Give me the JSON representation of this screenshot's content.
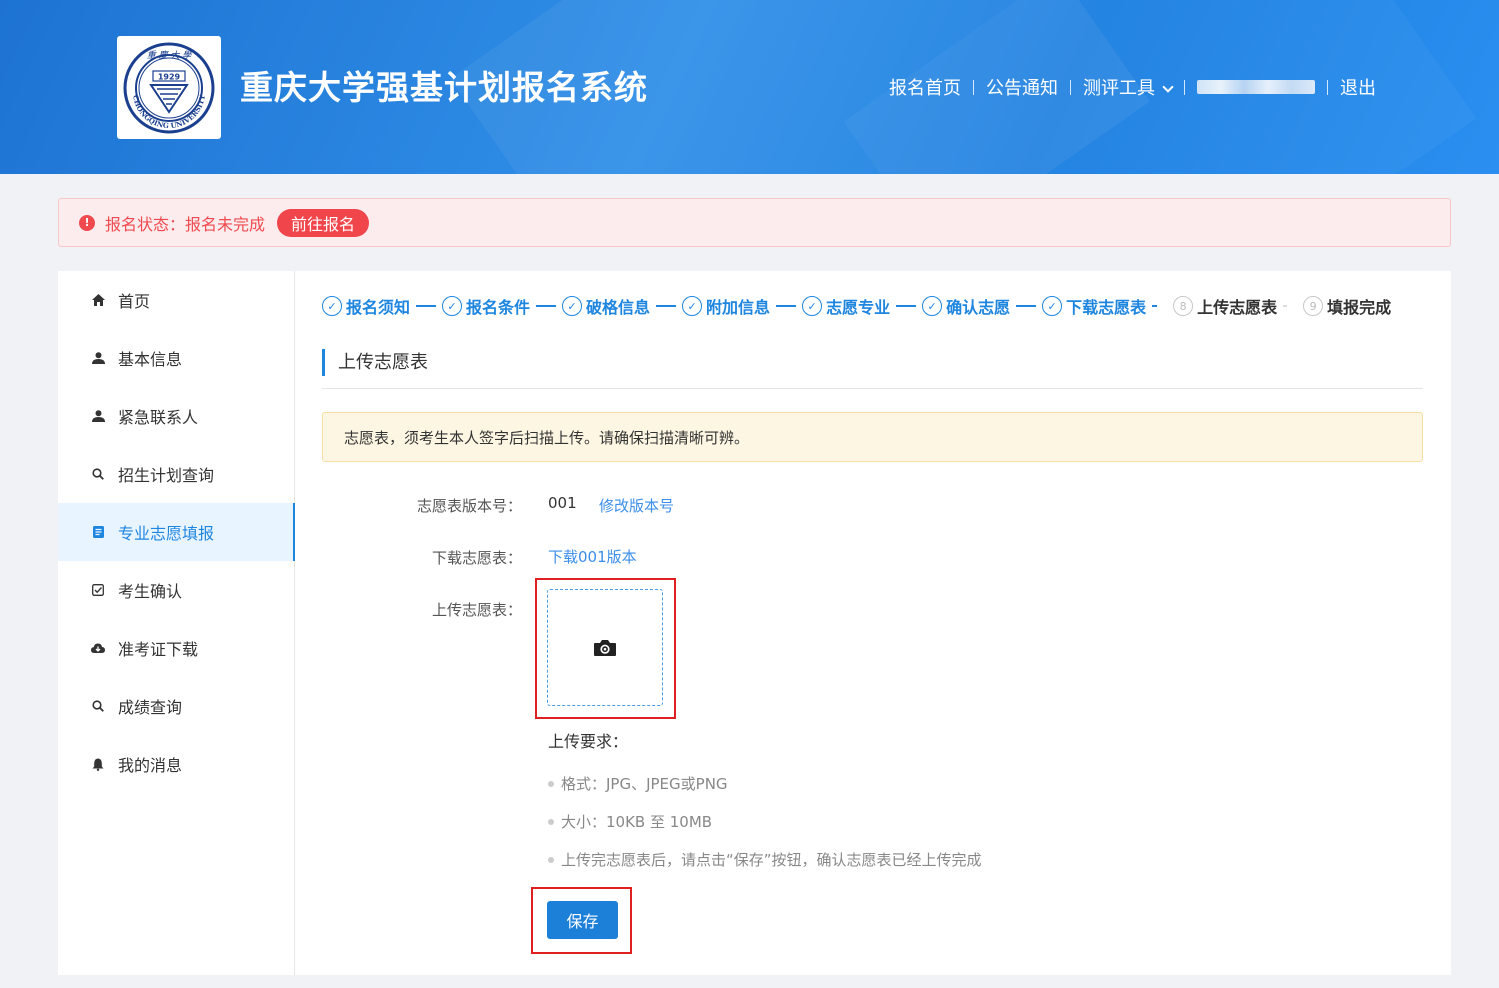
{
  "header": {
    "site_title": "重庆大学强基计划报名系统",
    "logo_alt_text": "重庆大学 1929 CHONGQING UNIVERSITY",
    "nav": {
      "home": "报名首页",
      "notices": "公告通知",
      "tools": "测评工具",
      "logout": "退出"
    }
  },
  "status": {
    "icon": "!",
    "text": "报名状态：报名未完成",
    "button": "前往报名"
  },
  "sidebar": {
    "items": [
      {
        "label": "首页",
        "icon": "home-icon"
      },
      {
        "label": "基本信息",
        "icon": "user-icon"
      },
      {
        "label": "紧急联系人",
        "icon": "user-icon"
      },
      {
        "label": "招生计划查询",
        "icon": "search-icon"
      },
      {
        "label": "专业志愿填报",
        "icon": "document-icon",
        "active": true
      },
      {
        "label": "考生确认",
        "icon": "checkbox-icon"
      },
      {
        "label": "准考证下载",
        "icon": "cloud-download-icon"
      },
      {
        "label": "成绩查询",
        "icon": "search-icon"
      },
      {
        "label": "我的消息",
        "icon": "bell-icon"
      }
    ]
  },
  "steps": {
    "items": [
      {
        "label": "报名须知",
        "marker": "✓",
        "state": "done"
      },
      {
        "label": "报名条件",
        "marker": "✓",
        "state": "done"
      },
      {
        "label": "破格信息",
        "marker": "✓",
        "state": "done"
      },
      {
        "label": "附加信息",
        "marker": "✓",
        "state": "done"
      },
      {
        "label": "志愿专业",
        "marker": "✓",
        "state": "done"
      },
      {
        "label": "确认志愿",
        "marker": "✓",
        "state": "done"
      },
      {
        "label": "下载志愿表",
        "marker": "✓",
        "state": "done"
      },
      {
        "label": "上传志愿表",
        "marker": "8",
        "state": "current"
      },
      {
        "label": "填报完成",
        "marker": "9",
        "state": "todo"
      }
    ]
  },
  "main": {
    "section_title": "上传志愿表",
    "notice": "志愿表，须考生本人签字后扫描上传。请确保扫描清晰可辨。",
    "form": {
      "version_label": "志愿表版本号：",
      "version_value": "001",
      "modify_link": "修改版本号",
      "download_label": "下载志愿表：",
      "download_link": "下载001版本",
      "upload_label": "上传志愿表："
    },
    "requirements": {
      "title": "上传要求：",
      "items": [
        "格式：JPG、JPEG或PNG",
        "大小：10KB 至 10MB",
        "上传完志愿表后，请点击“保存”按钮，确认志愿表已经上传完成"
      ]
    },
    "save_button": "保存"
  },
  "colors": {
    "primary": "#1f86e0",
    "header_blue": "#2a89e8",
    "danger": "#f04a4f",
    "warning_bg": "#fdf6e3",
    "highlight_outline": "#e02020"
  }
}
